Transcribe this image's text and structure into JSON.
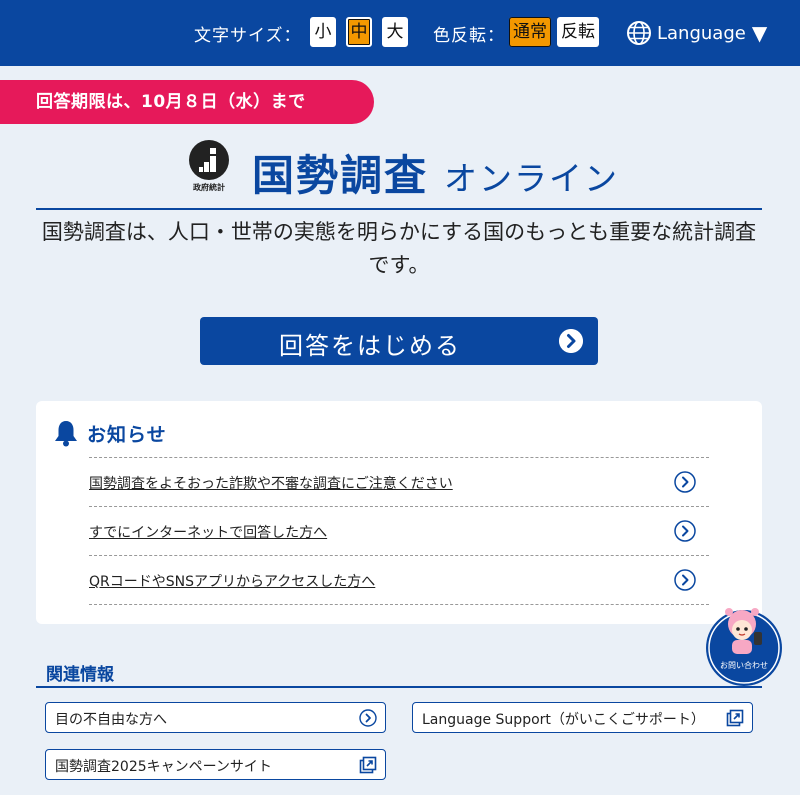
{
  "header": {
    "font_size_label": "文字サイズ：",
    "font_sizes": [
      "小",
      "中",
      "大"
    ],
    "font_size_selected": "中",
    "color_label": "色反転：",
    "color_modes": [
      "通常",
      "反転"
    ],
    "color_selected": "通常",
    "language_label": "Language",
    "language_icon": "globe-icon",
    "language_caret": "▼"
  },
  "deadline": "回答期限は、10月８日（水）まで",
  "logo": {
    "caption": "政府統計",
    "title": "国勢調査",
    "subtitle": "オンライン"
  },
  "lead_text": "国勢調査は、人口・世帯の実態を明らかにする国のもっとも重要な統計調査です。",
  "start_button": {
    "label": "回答をはじめる",
    "icon": "chevron-right-circle-icon"
  },
  "notices": {
    "title": "お知らせ",
    "icon": "bell-icon",
    "items": [
      {
        "text": "国勢調査をよそおった詐欺や不審な調査にご注意ください"
      },
      {
        "text": "すでにインターネットで回答した方へ"
      },
      {
        "text": "QRコードやSNSアプリからアクセスした方へ"
      }
    ]
  },
  "mascot": {
    "label": "お問い合わせ"
  },
  "related": {
    "title": "関連情報",
    "links": [
      {
        "text": "目の不自由な方へ",
        "icon": "chevron-right-circle-icon"
      },
      {
        "text": "Language Support（がいこくごサポート）",
        "icon": "external-link-icon"
      },
      {
        "text": "国勢調査2025キャンペーンサイト",
        "icon": "external-link-icon"
      }
    ]
  },
  "colors": {
    "brand_blue": "#0a47a0",
    "deadline_pink": "#e6195a",
    "active_orange": "#f39800",
    "background": "#eaf0f7"
  }
}
